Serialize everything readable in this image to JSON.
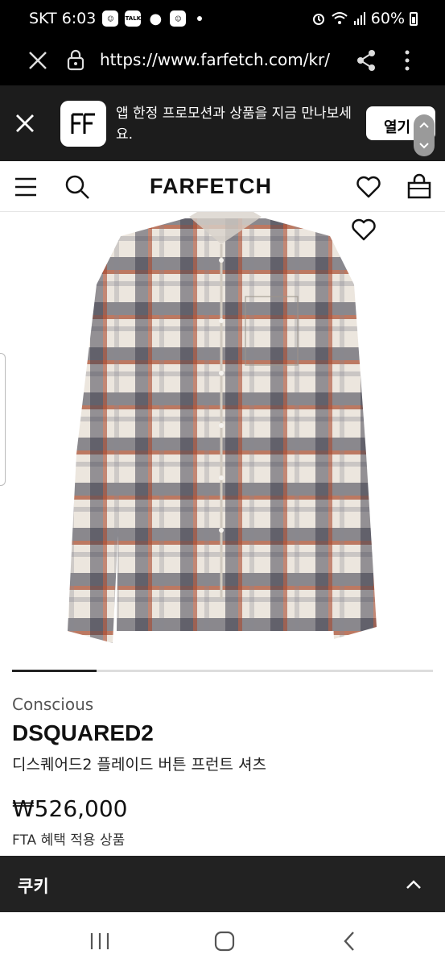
{
  "status_bar": {
    "carrier_time": "SKT 6:03",
    "notifications": [
      "baby-icon",
      "TALK",
      "chat-bubble-icon",
      "baby-icon"
    ],
    "talk_label": "TALK",
    "battery": "60%"
  },
  "browser": {
    "url": "https://www.farfetch.com/kr/"
  },
  "app_banner": {
    "text": "앱 한정 프로모션과 상품을 지금 만나보세요.",
    "open_label": "열기"
  },
  "header": {
    "logo": "FARFETCH"
  },
  "carousel": {
    "current_progress": 0.2
  },
  "product": {
    "tag": "Conscious",
    "brand": "DSQUARED2",
    "name": "디스퀘어드2 플레이드 버튼 프런트 셔츠",
    "price": "₩526,000",
    "fta_note": "FTA 혜택 적용 상품"
  },
  "cookie_bar": {
    "label": "쿠키"
  },
  "colors": {
    "status_bg": "#000000",
    "banner_bg": "#1c1c1c",
    "cookie_bg": "#222222",
    "shirt_red": "#a84a2e",
    "shirt_navy": "#3a3a4a",
    "shirt_cream": "#ece6de"
  }
}
